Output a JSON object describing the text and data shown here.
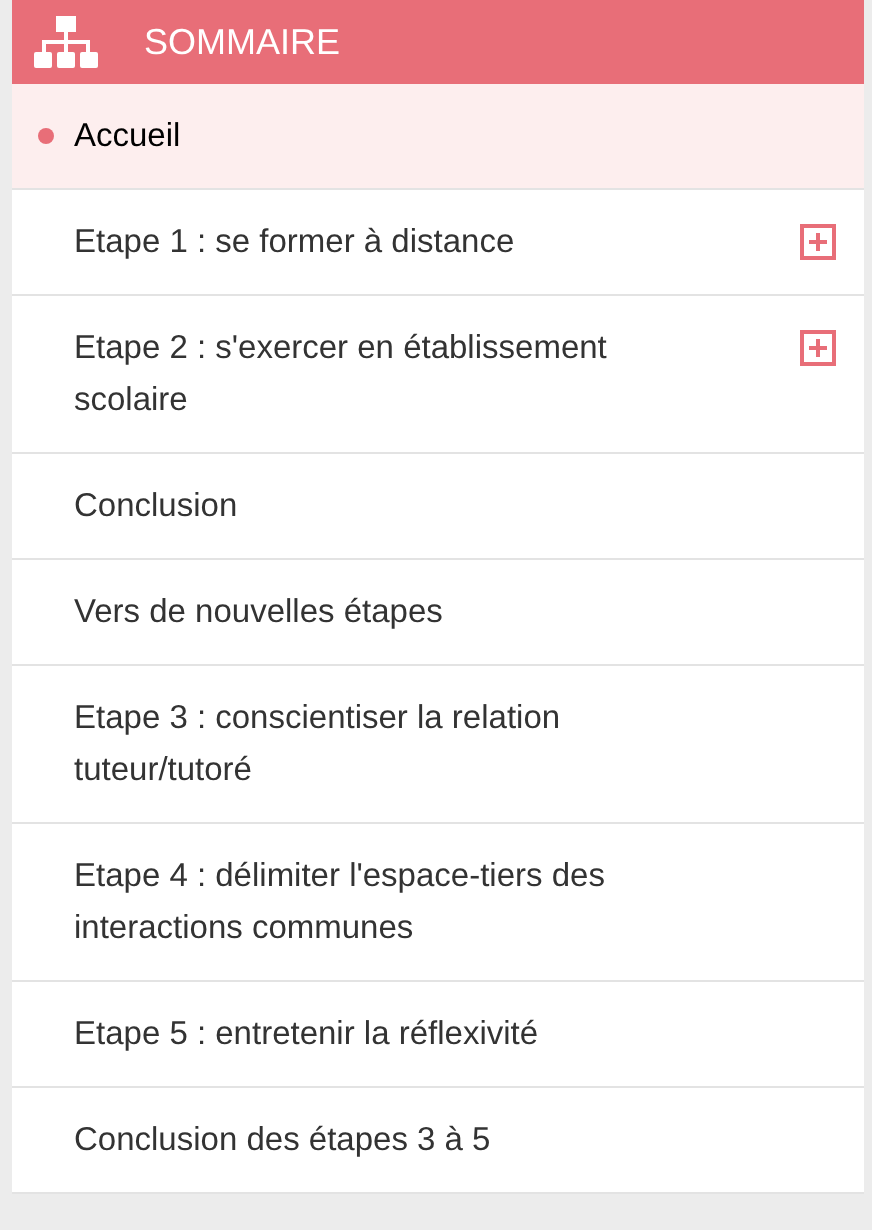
{
  "header": {
    "title": "SOMMAIRE"
  },
  "items": [
    {
      "label": "Accueil",
      "kind": "page",
      "selected": true
    },
    {
      "label": "Etape 1 : se former à distance",
      "kind": "section",
      "selected": false
    },
    {
      "label": "Etape 2 : s'exercer en établissement scolaire",
      "kind": "section",
      "selected": false
    },
    {
      "label": "Conclusion",
      "kind": "page",
      "selected": false
    },
    {
      "label": "Vers de nouvelles étapes",
      "kind": "page",
      "selected": false
    },
    {
      "label": "Etape 3 : conscientiser la relation tuteur/tutoré",
      "kind": "page",
      "selected": false
    },
    {
      "label": "Etape 4 : délimiter l'espace-tiers des interactions communes",
      "kind": "page",
      "selected": false
    },
    {
      "label": "Etape 5 : entretenir la réflexivité",
      "kind": "page",
      "selected": false
    },
    {
      "label": "Conclusion des étapes 3 à 5",
      "kind": "page",
      "selected": false
    }
  ]
}
